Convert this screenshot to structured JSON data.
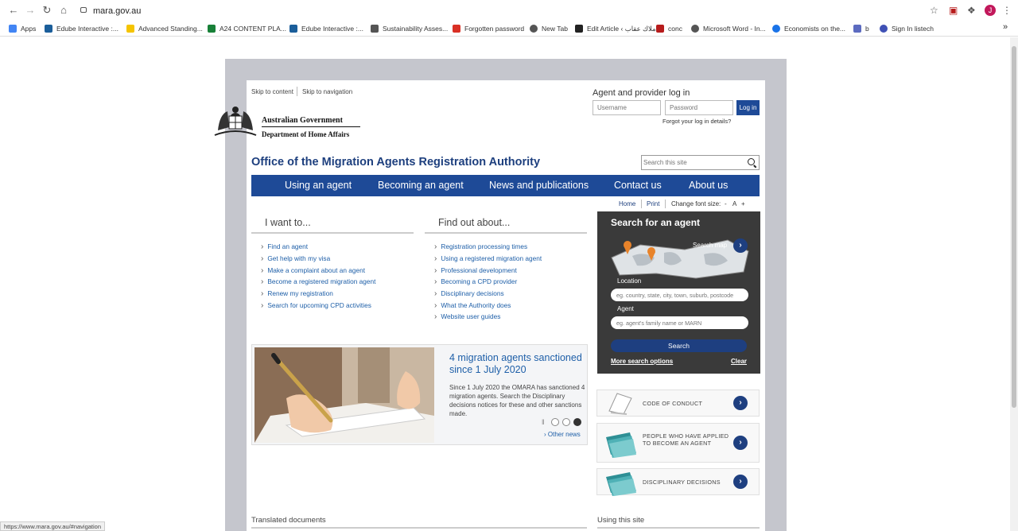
{
  "browser": {
    "url": "mara.gov.au",
    "bookmarks": [
      {
        "label": "Apps",
        "color": "#4285f4"
      },
      {
        "label": "Edube Interactive :...",
        "color": "#1b5e9a"
      },
      {
        "label": "Advanced Standing...",
        "color": "#f5c400"
      },
      {
        "label": "A24 CONTENT PLA...",
        "color": "#188038"
      },
      {
        "label": "Edube Interactive :...",
        "color": "#1b5e9a"
      },
      {
        "label": "Sustainability Asses...",
        "color": "#555555"
      },
      {
        "label": "Forgotten password",
        "color": "#d93025"
      },
      {
        "label": "New Tab",
        "color": "#555555"
      },
      {
        "label": "Edit Article ‹ ملاك عقاب",
        "color": "#222222"
      },
      {
        "label": "conc",
        "color": "#b71c1c"
      },
      {
        "label": "Microsoft Word - In...",
        "color": "#555555"
      },
      {
        "label": "Economists on the...",
        "color": "#1a73e8"
      },
      {
        "label": "b",
        "color": "#5c6bc0"
      },
      {
        "label": "Sign In listech",
        "color": "#3f51b5"
      }
    ],
    "status_url": "https://www.mara.gov.au/#navigation",
    "avatar_letter": "J"
  },
  "header": {
    "skip_content": "Skip to content",
    "skip_navigation": "Skip to navigation",
    "login_title": "Agent and provider log in",
    "username_placeholder": "Username",
    "password_placeholder": "Password",
    "login_button": "Log in",
    "forgot": "Forgot your log in details?",
    "gov_line1": "Australian Government",
    "gov_line2": "Department of Home Affairs",
    "office_title": "Office of the Migration Agents Registration Authority",
    "search_placeholder": "Search this site"
  },
  "nav": [
    "Using an agent",
    "Becoming an agent",
    "News and publications",
    "Contact us",
    "About us"
  ],
  "utility": {
    "home": "Home",
    "print": "Print",
    "font_size": "Change font size:",
    "minus": "-",
    "a": "A",
    "plus": "+"
  },
  "i_want_to": {
    "heading": "I want to...",
    "links": [
      "Find an agent",
      "Get help with my visa",
      "Make a complaint about an agent",
      "Become a registered migration agent",
      "Renew my registration",
      "Search for upcoming CPD activities"
    ]
  },
  "find_out": {
    "heading": "Find out about...",
    "links": [
      "Registration processing times",
      "Using a registered migration agent",
      "Professional development",
      "Becoming a CPD provider",
      "Disciplinary decisions",
      "What the Authority does",
      "Website user guides"
    ]
  },
  "agent_search": {
    "title": "Search for an agent",
    "search_map": "Search map",
    "location_label": "Location",
    "location_placeholder": "eg. country, state, city, town, suburb, postcode",
    "agent_label": "Agent",
    "agent_placeholder": "eg. agent's family name or MARN",
    "search_button": "Search",
    "more_options": "More search options",
    "clear": "Clear"
  },
  "news": {
    "title": "4 migration agents sanctioned since 1 July 2020",
    "body": "Since 1 July 2020 the OMARA has sanctioned 4 migration agents. Search the Disciplinary decisions notices for these and other sanctions made.",
    "other_news": "› Other news"
  },
  "cards": [
    {
      "label": "CODE OF CONDUCT"
    },
    {
      "label": "PEOPLE WHO HAVE APPLIED TO BECOME AN AGENT"
    },
    {
      "label": "DISCIPLINARY DECISIONS"
    }
  ],
  "bottom": {
    "translated": "Translated documents",
    "using": "Using this site"
  },
  "colors": {
    "brand_blue": "#1e4a97",
    "title_blue": "#1d3f7e",
    "link_blue": "#1e5fa8",
    "panel_dark": "#3a3a3a",
    "frame_grey": "#c5c6cd"
  }
}
